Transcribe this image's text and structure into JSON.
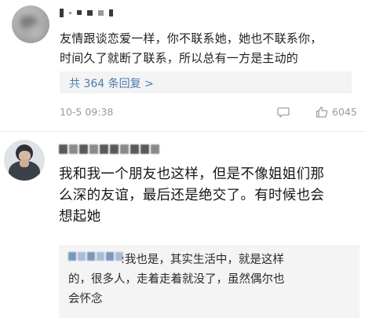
{
  "comment1": {
    "text_lines": [
      "友情跟谈恋爱一样，你不联系她，她也不联系你，",
      "时间久了就断了联系，所以总有一方是主动的"
    ],
    "reply_link": "共 364 条回复 >",
    "timestamp": "10-5 09:38",
    "like_count": "6045"
  },
  "comment2": {
    "text_lines": [
      "我和我一个朋友也这样，但是不像姐姐们那",
      "么深的友谊，最后还是绝交了。有时候也会",
      "想起她"
    ],
    "sub_reply": {
      "text_lines": [
        ":我也是，其实生活中，就是这样",
        "的，很多人，走着走着就没了，虽然偶尔也",
        "会怀念"
      ]
    }
  },
  "colors": {
    "link": "#4d7cb0",
    "meta_gray": "#999999",
    "reply_bg": "#f3f3f3"
  },
  "icons": [
    "reply-icon",
    "like-icon"
  ]
}
